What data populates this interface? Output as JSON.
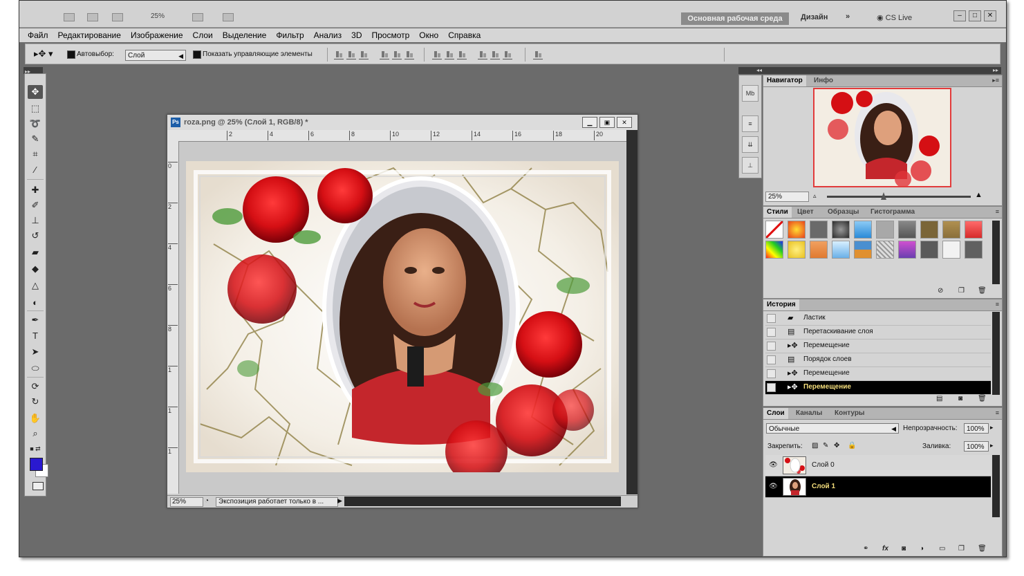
{
  "app": {
    "zoom_display": "25%",
    "workspace_button": "Основная рабочая среда",
    "workspace_design": "Дизайн",
    "workspace_more": "»",
    "cs_live": "CS Live"
  },
  "menu": [
    "Файл",
    "Редактирование",
    "Изображение",
    "Слои",
    "Выделение",
    "Фильтр",
    "Анализ",
    "3D",
    "Просмотр",
    "Окно",
    "Справка"
  ],
  "options": {
    "autoselect_label": "Автовыбор:",
    "autoselect_value": "Слой",
    "show_controls_label": "Показать управляющие элементы"
  },
  "document": {
    "title": "roza.png @ 25% (Слой 1, RGB/8) *",
    "ruler_h": [
      "2",
      "4",
      "6",
      "8",
      "10",
      "12",
      "14",
      "16",
      "18",
      "20"
    ],
    "ruler_v": [
      "0",
      "2",
      "4",
      "6",
      "8",
      "1",
      "1",
      "1"
    ],
    "status_zoom": "25%",
    "status_msg": "Экспозиция работает только в ..."
  },
  "navigator": {
    "tab_active": "Навигатор",
    "tab_other": "Инфо",
    "zoom": "25%"
  },
  "styles_panel": {
    "tabs": [
      "Стили",
      "Цвет",
      "Образцы",
      "Гистограмма"
    ],
    "swatches": [
      "#ffffff",
      "#e8401a",
      "#6a6a6a",
      "#2b2b2b",
      "#2a8ad8",
      "#a8a8a8",
      "#555555",
      "#7a6538",
      "#8a6f3a",
      "#d62a2a",
      "#c040c0",
      "#e8c020",
      "#e07a30",
      "#6ab0e8",
      "#4a8fd0",
      "#b8b8b8",
      "#6a3fb0",
      "#5a5a5a",
      "#f2f2f2",
      "#606060"
    ]
  },
  "history": {
    "title": "История",
    "items": [
      "Ластик",
      "Перетаскивание слоя",
      "Перемещение",
      "Порядок слоев",
      "Перемещение",
      "Перемещение"
    ]
  },
  "layers": {
    "tabs": [
      "Слои",
      "Каналы",
      "Контуры"
    ],
    "blend_mode": "Обычные",
    "opacity_label": "Непрозрачность:",
    "opacity_value": "100%",
    "lock_label": "Закрепить:",
    "fill_label": "Заливка:",
    "fill_value": "100%",
    "items": [
      "Слой 0",
      "Слой 1"
    ]
  },
  "colors": {
    "foreground": "#2a19d0",
    "background": "#ffffff",
    "selected_row": "#000000",
    "selected_text": "#f6df7c",
    "canvas_gray": "#6b6b6b"
  }
}
